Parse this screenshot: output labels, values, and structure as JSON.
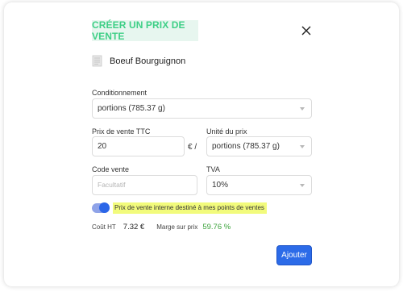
{
  "modal": {
    "title": "CRÉER UN PRIX DE VENTE",
    "close_icon": "close-icon"
  },
  "product": {
    "icon": "document-icon",
    "name": "Boeuf Bourguignon"
  },
  "conditionnement": {
    "label": "Conditionnement",
    "value": "portions (785.37 g)"
  },
  "prix_vente": {
    "label": "Prix de vente TTC",
    "value": "20",
    "unit_suffix": "€ /"
  },
  "unite_prix": {
    "label": "Unité du prix",
    "value": "portions (785.37 g)"
  },
  "code_vente": {
    "label": "Code vente",
    "placeholder": "Facultatif"
  },
  "tva": {
    "label": "TVA",
    "value": "10%"
  },
  "toggle": {
    "label": "Prix de vente interne destiné à mes points de ventes",
    "checked": true
  },
  "summary": {
    "cout_label": "Coût HT",
    "cout_value": "7.32 €",
    "marge_label": "Marge sur prix",
    "marge_value": "59.76 %"
  },
  "actions": {
    "submit_label": "Ajouter"
  },
  "colors": {
    "title_text": "#3ecf86",
    "title_bg": "#e7f6ef",
    "primary": "#2c6be8",
    "marge": "#3ca33c",
    "highlight": "#f2fb7c"
  }
}
